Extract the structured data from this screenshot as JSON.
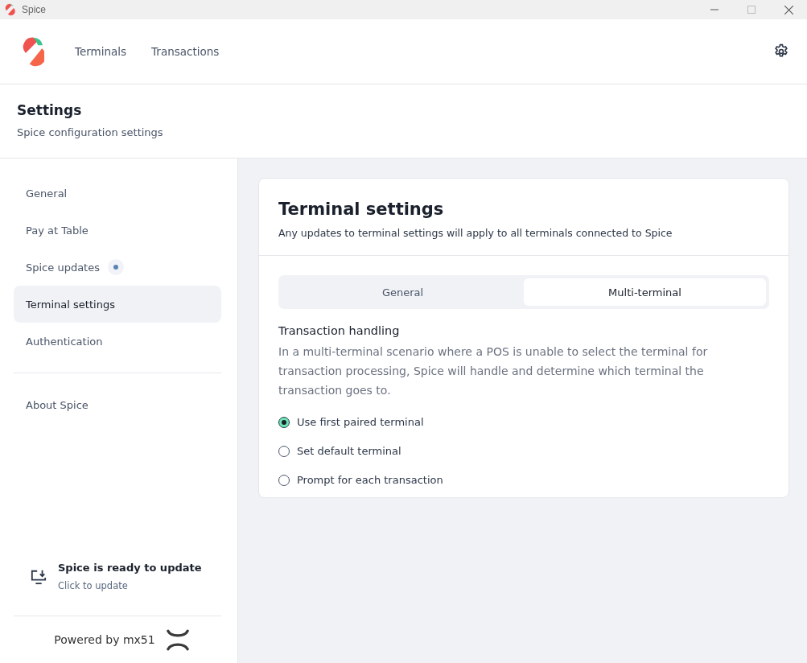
{
  "window": {
    "title": "Spice"
  },
  "nav": [
    {
      "label": "Terminals",
      "selected": false
    },
    {
      "label": "Transactions",
      "selected": false
    }
  ],
  "page": {
    "title": "Settings",
    "subtitle": "Spice configuration settings"
  },
  "sidebar": {
    "groups": [
      {
        "items": [
          {
            "label": "General",
            "selected": false,
            "badge": false
          },
          {
            "label": "Pay at Table",
            "selected": false,
            "badge": false
          },
          {
            "label": "Spice updates",
            "selected": false,
            "badge": true
          },
          {
            "label": "Terminal settings",
            "selected": true,
            "badge": false
          },
          {
            "label": "Authentication",
            "selected": false,
            "badge": false
          }
        ]
      },
      {
        "items": [
          {
            "label": "About Spice",
            "selected": false,
            "badge": false
          }
        ]
      }
    ],
    "update_notice": {
      "title": "Spice is ready to update",
      "action": "Click to update"
    },
    "footer": "Powered by mx51"
  },
  "card": {
    "title": "Terminal settings",
    "subtitle": "Any updates to terminal settings will apply to all terminals connected to Spice",
    "tabs": [
      {
        "label": "General",
        "selected": false
      },
      {
        "label": "Multi-terminal",
        "selected": true
      }
    ],
    "section_title": "Transaction handling",
    "description": "In a multi-terminal scenario where a POS is unable to select the terminal for transaction processing, Spice will handle and determine which terminal the transaction goes to.",
    "options": [
      {
        "label": "Use first paired terminal",
        "selected": true
      },
      {
        "label": "Set default terminal",
        "selected": false
      },
      {
        "label": "Prompt for each transaction",
        "selected": false
      }
    ]
  }
}
